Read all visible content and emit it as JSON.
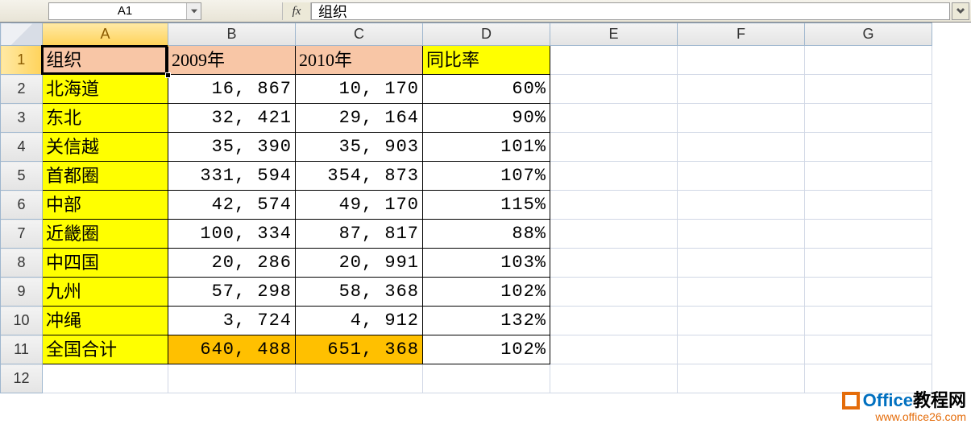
{
  "formulaBar": {
    "nameBox": "A1",
    "fxLabel": "fx",
    "formulaValue": "组织"
  },
  "columns": [
    "A",
    "B",
    "C",
    "D",
    "E",
    "F",
    "G"
  ],
  "rowNumbers": [
    "1",
    "2",
    "3",
    "4",
    "5",
    "6",
    "7",
    "8",
    "9",
    "10",
    "11",
    "12"
  ],
  "headerRow": {
    "A": "组织",
    "B": "2009年",
    "C": "2010年",
    "D": "同比率"
  },
  "dataRows": [
    {
      "org": "北海道",
      "y2009": "16, 867",
      "y2010": "10, 170",
      "rate": "60%"
    },
    {
      "org": "东北",
      "y2009": "32, 421",
      "y2010": "29, 164",
      "rate": "90%"
    },
    {
      "org": "关信越",
      "y2009": "35, 390",
      "y2010": "35, 903",
      "rate": "101%"
    },
    {
      "org": "首都圈",
      "y2009": "331, 594",
      "y2010": "354, 873",
      "rate": "107%"
    },
    {
      "org": "中部",
      "y2009": "42, 574",
      "y2010": "49, 170",
      "rate": "115%"
    },
    {
      "org": "近畿圈",
      "y2009": "100, 334",
      "y2010": "87, 817",
      "rate": "88%"
    },
    {
      "org": "中四国",
      "y2009": "20, 286",
      "y2010": "20, 991",
      "rate": "103%"
    },
    {
      "org": "九州",
      "y2009": "57, 298",
      "y2010": "58, 368",
      "rate": "102%"
    },
    {
      "org": "冲绳",
      "y2009": "3, 724",
      "y2010": "4, 912",
      "rate": "132%"
    }
  ],
  "totalRow": {
    "org": "全国合计",
    "y2009": "640, 488",
    "y2010": "651, 368",
    "rate": "102%"
  },
  "watermark": {
    "brandPrefix": "Office",
    "brandSuffix": "教程网",
    "url": "www.office26.com"
  },
  "chart_data": {
    "type": "table",
    "title": "",
    "columns": [
      "组织",
      "2009年",
      "2010年",
      "同比率"
    ],
    "rows": [
      [
        "北海道",
        16867,
        10170,
        0.6
      ],
      [
        "东北",
        32421,
        29164,
        0.9
      ],
      [
        "关信越",
        35390,
        35903,
        1.01
      ],
      [
        "首都圈",
        331594,
        354873,
        1.07
      ],
      [
        "中部",
        42574,
        49170,
        1.15
      ],
      [
        "近畿圈",
        100334,
        87817,
        0.88
      ],
      [
        "中四国",
        20286,
        20991,
        1.03
      ],
      [
        "九州",
        57298,
        58368,
        1.02
      ],
      [
        "冲绳",
        3724,
        4912,
        1.32
      ],
      [
        "全国合计",
        640488,
        651368,
        1.02
      ]
    ]
  }
}
